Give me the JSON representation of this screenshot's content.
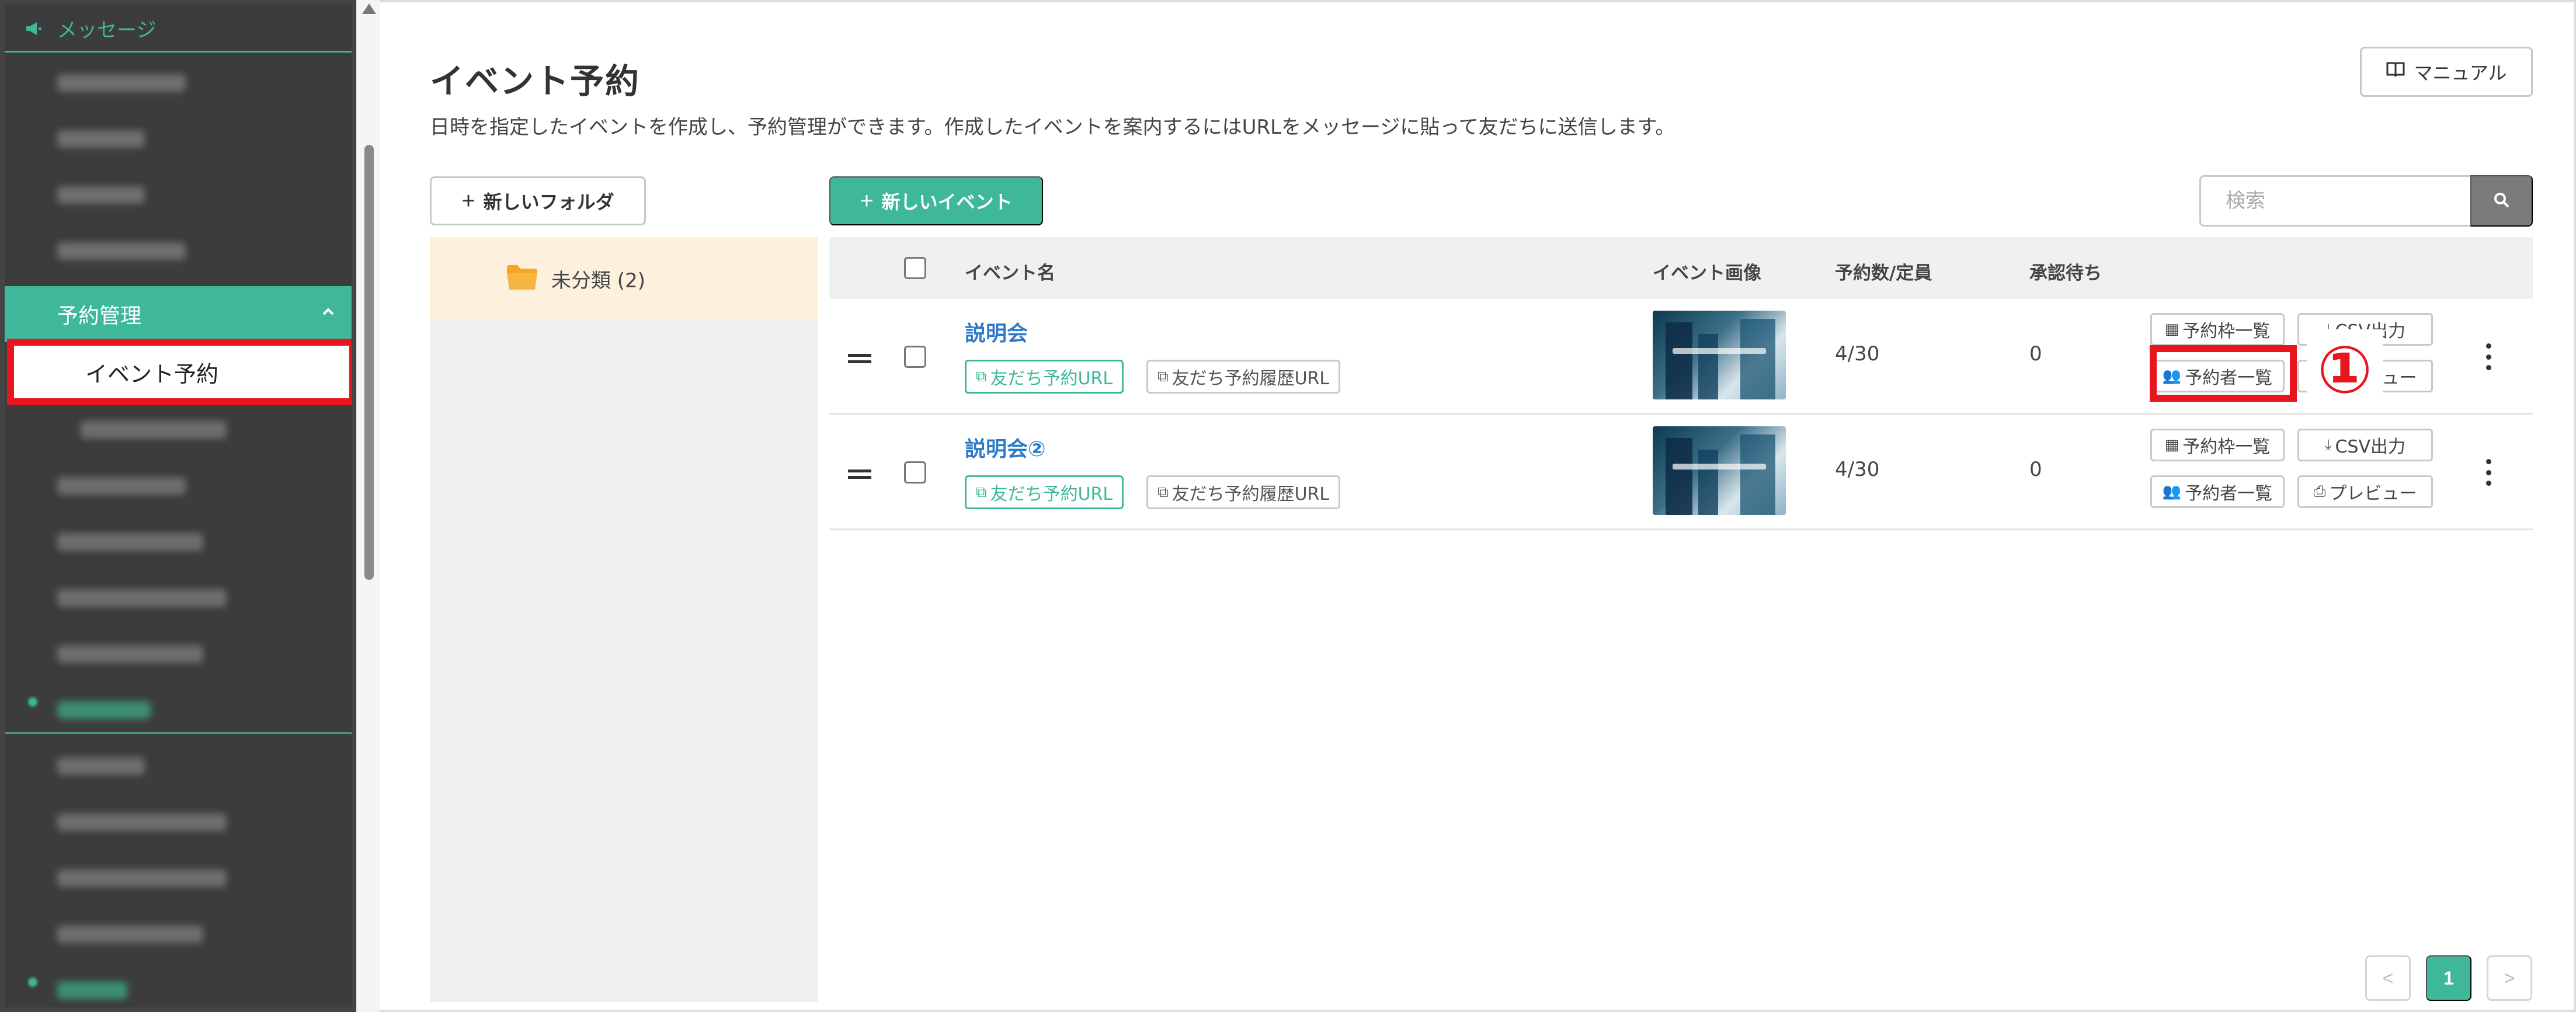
{
  "sidebar": {
    "group_top": {
      "label": "メッセージ",
      "icon": "megaphone-icon"
    },
    "parent_active": "予約管理",
    "selected_item": "イベント予約"
  },
  "page": {
    "title": "イベント予約",
    "description": "日時を指定したイベントを作成し、予約管理ができます。作成したイベントを案内するにはURLをメッセージに貼って友だちに送信します。",
    "manual_button": "マニュアル"
  },
  "toolbar": {
    "new_folder": "新しいフォルダ",
    "new_event": "新しいイベント",
    "search_placeholder": "検索"
  },
  "folders": [
    {
      "label": "未分類 (2)"
    }
  ],
  "table": {
    "headers": {
      "name": "イベント名",
      "image": "イベント画像",
      "reservations": "予約数/定員",
      "pending": "承認待ち"
    },
    "rows": [
      {
        "name": "説明会",
        "friend_url": "友だち予約URL",
        "history_url": "友だち予約履歴URL",
        "reservations": "4/30",
        "pending": "0",
        "slots_button": "予約枠一覧",
        "csv_button": "CSV出力",
        "members_button": "予約者一覧",
        "preview_button": "プレビュー"
      },
      {
        "name": "説明会②",
        "friend_url": "友だち予約URL",
        "history_url": "友だち予約履歴URL",
        "reservations": "4/30",
        "pending": "0",
        "slots_button": "予約枠一覧",
        "csv_button": "CSV出力",
        "members_button": "予約者一覧",
        "preview_button": "プレビュー"
      }
    ]
  },
  "annotation": {
    "step": "①",
    "color": "#e8141e"
  },
  "pagination": {
    "current": "1",
    "prev": "<",
    "next": ">"
  },
  "colors": {
    "accent": "#3fb79a",
    "link": "#2b7bc9",
    "folder": "#f5a623",
    "highlight": "#e8141e"
  }
}
